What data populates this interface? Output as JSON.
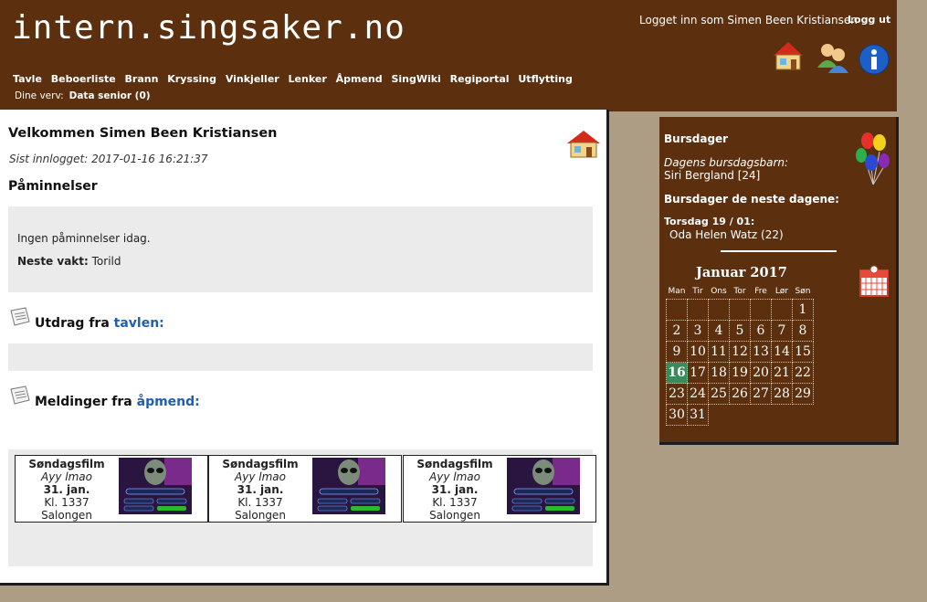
{
  "header": {
    "logo": "intern.singsaker.no",
    "login_text": "Logget inn som Simen Been Kristiansen",
    "logout": "Logg ut",
    "nav": [
      "Tavle",
      "Beboerliste",
      "Brann",
      "Kryssing",
      "Vinkjeller",
      "Lenker",
      "Åpmend",
      "SingWiki",
      "Regiportal",
      "Utflytting"
    ],
    "verv_label": "Dine verv:",
    "verv_value": "Data senior (0)"
  },
  "main": {
    "welcome": "Velkommen Simen Been Kristiansen",
    "last_login": "Sist innlogget: 2017-01-16 16:21:37",
    "reminders_title": "Påminnelser",
    "no_reminders": "Ingen påminnelser idag.",
    "next_shift_label": "Neste vakt:",
    "next_shift_value": "Torild",
    "board_prefix": "Utdrag fra",
    "board_link": "tavlen:",
    "messages_prefix": "Meldinger fra",
    "messages_link": "åpmend:",
    "events": [
      {
        "title": "Søndagsfilm",
        "subtitle": "Ayy lmao",
        "date": "31. jan.",
        "time": "Kl. 1337",
        "place": "Salongen"
      },
      {
        "title": "Søndagsfilm",
        "subtitle": "Ayy lmao",
        "date": "31. jan.",
        "time": "Kl. 1337",
        "place": "Salongen"
      },
      {
        "title": "Søndagsfilm",
        "subtitle": "Ayy lmao",
        "date": "31. jan.",
        "time": "Kl. 1337",
        "place": "Salongen"
      }
    ]
  },
  "side": {
    "title": "Bursdager",
    "today_label": "Dagens bursdagsbarn:",
    "today_name": "Siri Bergland [24]",
    "next_title": "Bursdager de neste dagene:",
    "next_day": "Torsdag 19 / 01:",
    "next_person": "Oda Helen Watz (22)",
    "calendar_title": "Januar 2017",
    "weekdays": [
      "Man",
      "Tir",
      "Ons",
      "Tor",
      "Fre",
      "Lør",
      "Søn"
    ],
    "weeks": [
      [
        "",
        "",
        "",
        "",
        "",
        "",
        "1"
      ],
      [
        "2",
        "3",
        "4",
        "5",
        "6",
        "7",
        "8"
      ],
      [
        "9",
        "10",
        "11",
        "12",
        "13",
        "14",
        "15"
      ],
      [
        "16",
        "17",
        "18",
        "19",
        "20",
        "21",
        "22"
      ],
      [
        "23",
        "24",
        "25",
        "26",
        "27",
        "28",
        "29"
      ],
      [
        "30",
        "31",
        "",
        "",
        "",
        "",
        ""
      ]
    ],
    "today": "16"
  },
  "colors": {
    "header_bg": "#5c300f",
    "page_bg": "#ad9d84",
    "link": "#1f5fb0",
    "today_cell": "#3c8a5a"
  }
}
